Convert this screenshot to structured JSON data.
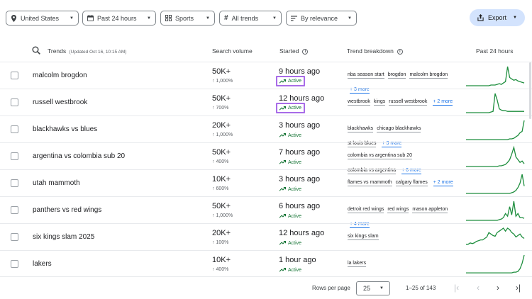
{
  "filters": {
    "geo": "United States",
    "time": "Past 24 hours",
    "category": "Sports",
    "trend_type": "All trends",
    "sort": "By relevance",
    "export_label": "Export"
  },
  "header": {
    "trends": "Trends",
    "updated": "(Updated Oct 16, 10:15 AM)",
    "search_volume": "Search volume",
    "started": "Started",
    "breakdown": "Trend breakdown",
    "past24": "Past 24 hours"
  },
  "rows": [
    {
      "name": "malcolm brogdon",
      "volume": "50K+",
      "pct": "1,000%",
      "started": "9 hours ago",
      "status": "Active",
      "tags": [
        "nba season start",
        "brogdon",
        "malcolm brogdon"
      ],
      "more": "+ 3 more",
      "spark": [
        0,
        0,
        0,
        0,
        0,
        0,
        0,
        0,
        0,
        0,
        0,
        0,
        1,
        1,
        1,
        2,
        3,
        2,
        4,
        6,
        28,
        12,
        10,
        8,
        9,
        7,
        6,
        5,
        4
      ]
    },
    {
      "name": "russell westbrook",
      "volume": "50K+",
      "pct": "700%",
      "started": "12 hours ago",
      "status": "Active",
      "tags": [
        "westbrook",
        "kings",
        "russell westbrook"
      ],
      "more": "+ 2 more",
      "spark": [
        0,
        0,
        0,
        0,
        0,
        0,
        0,
        0,
        0,
        0,
        0,
        0,
        1,
        2,
        30,
        20,
        6,
        4,
        3,
        3,
        2,
        2,
        2,
        2,
        2,
        2,
        2,
        2,
        2
      ]
    },
    {
      "name": "blackhawks vs blues",
      "volume": "20K+",
      "pct": "1,000%",
      "started": "3 hours ago",
      "status": "Active",
      "tags": [
        "blackhawks",
        "chicago blackhawks",
        "st louis blues"
      ],
      "more": "+ 3 more",
      "spark": [
        0,
        0,
        0,
        0,
        0,
        0,
        0,
        0,
        0,
        0,
        0,
        0,
        0,
        0,
        0,
        0,
        0,
        0,
        0,
        0,
        0,
        1,
        1,
        2,
        4,
        6,
        10,
        12,
        28
      ]
    },
    {
      "name": "argentina vs colombia sub 20",
      "volume": "50K+",
      "pct": "400%",
      "started": "7 hours ago",
      "status": "Active",
      "tags": [
        "colombia vs argentina sub 20",
        "colombia vs argentina"
      ],
      "more": "+ 6 more",
      "spark": [
        0,
        0,
        0,
        0,
        0,
        0,
        0,
        0,
        0,
        0,
        0,
        0,
        0,
        0,
        0,
        0,
        1,
        1,
        2,
        3,
        6,
        10,
        18,
        28,
        14,
        10,
        6,
        8,
        4
      ]
    },
    {
      "name": "utah mammoth",
      "volume": "10K+",
      "pct": "600%",
      "started": "3 hours ago",
      "status": "Active",
      "tags": [
        "flames vs mammoth",
        "calgary flames"
      ],
      "more": "+ 2 more",
      "spark": [
        0,
        0,
        0,
        0,
        0,
        0,
        0,
        0,
        0,
        0,
        0,
        0,
        0,
        0,
        0,
        0,
        0,
        0,
        0,
        0,
        0,
        0,
        1,
        2,
        4,
        8,
        14,
        26,
        10
      ]
    },
    {
      "name": "panthers vs red wings",
      "volume": "50K+",
      "pct": "1,000%",
      "started": "6 hours ago",
      "status": "Active",
      "tags": [
        "detroit red wings",
        "red wings",
        "mason appleton"
      ],
      "more": "+ 4 more",
      "spark": [
        0,
        0,
        0,
        0,
        0,
        0,
        0,
        0,
        0,
        0,
        0,
        0,
        0,
        0,
        0,
        0,
        1,
        2,
        4,
        10,
        6,
        20,
        8,
        28,
        6,
        10,
        4,
        4,
        3
      ]
    },
    {
      "name": "six kings slam 2025",
      "volume": "20K+",
      "pct": "100%",
      "started": "12 hours ago",
      "status": "Active",
      "tags": [
        "six kings slam"
      ],
      "more": "",
      "spark": [
        4,
        4,
        6,
        5,
        6,
        8,
        9,
        10,
        10,
        12,
        14,
        20,
        18,
        16,
        15,
        20,
        22,
        24,
        26,
        22,
        26,
        24,
        20,
        18,
        14,
        16,
        18,
        14,
        12
      ]
    },
    {
      "name": "lakers",
      "volume": "10K+",
      "pct": "400%",
      "started": "1 hour ago",
      "status": "Active",
      "tags": [
        "la lakers"
      ],
      "more": "",
      "spark": [
        2,
        2,
        2,
        2,
        2,
        2,
        2,
        2,
        2,
        2,
        2,
        2,
        2,
        2,
        2,
        2,
        2,
        2,
        2,
        2,
        2,
        2,
        2,
        3,
        3,
        4,
        8,
        16,
        28
      ]
    }
  ],
  "footer": {
    "rows_per_page_label": "Rows per page",
    "rows_per_page": "25",
    "range": "1–25 of 143"
  },
  "colors": {
    "accent": "#1a73e8",
    "active": "#137333",
    "spark": "#1e8e3e",
    "highlight": "#a86ce8",
    "export_bg": "#d3e3fd"
  },
  "icons": [
    "location-pin-icon",
    "calendar-icon",
    "grid-icon",
    "hashtag-icon",
    "sort-icon",
    "share-icon",
    "search-icon",
    "info-icon",
    "trending-up-icon",
    "first-page-icon",
    "prev-page-icon",
    "next-page-icon",
    "last-page-icon"
  ]
}
